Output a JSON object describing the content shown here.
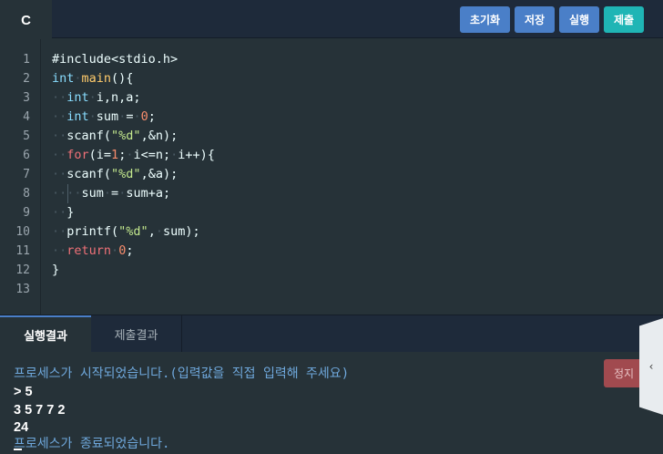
{
  "toolbar": {
    "language": "C",
    "buttons": [
      "초기화",
      "저장",
      "실행",
      "제출"
    ]
  },
  "editor": {
    "line_numbers": [
      "1",
      "2",
      "3",
      "4",
      "5",
      "6",
      "7",
      "8",
      "9",
      "10",
      "11",
      "12",
      "13"
    ]
  },
  "bottom_tabs": {
    "run_result": "실행결과",
    "submit_result": "제출결과"
  },
  "console": {
    "start_msg": "프로세스가 시작되었습니다.(입력값을 직접 입력해 주세요)",
    "input_line": "> 5",
    "input_values": "3 5 7 7 2",
    "output": "24",
    "end_msg": "프로세스가 종료되었습니다.",
    "stop_label": "정지"
  },
  "colors": {
    "accent_blue": "#4a7fc8",
    "accent_teal": "#1fb5b5",
    "stop_red": "#a14a4f"
  }
}
